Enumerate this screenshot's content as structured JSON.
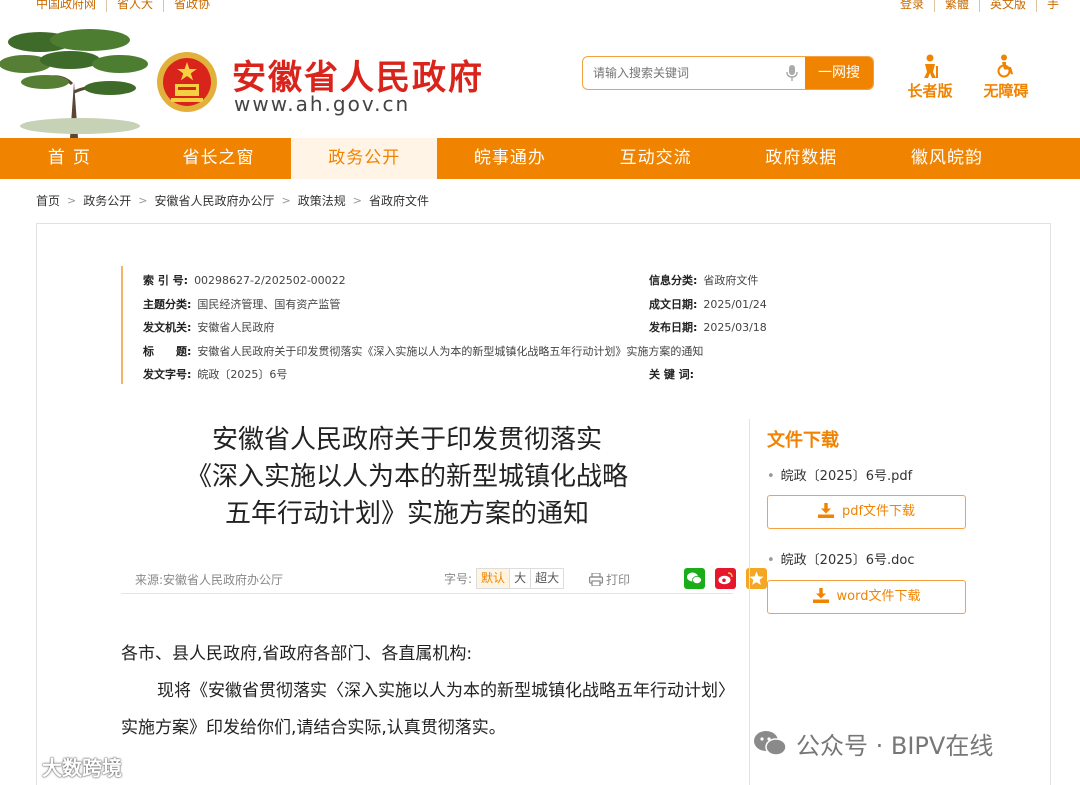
{
  "top_links": {
    "left": [
      "中国政府网",
      "省人大",
      "省政协"
    ],
    "right": [
      "登录",
      "繁體",
      "英文版",
      "手"
    ]
  },
  "header": {
    "site_title": "安徽省人民政府",
    "site_url": "www.ah.gov.cn",
    "search_placeholder": "请输入搜索关键词",
    "search_button": "一网搜",
    "elder_label": "长者版",
    "accessible_label": "无障碍"
  },
  "nav": {
    "items": [
      "首页",
      "省长之窗",
      "政务公开",
      "皖事通办",
      "互动交流",
      "政府数据",
      "徽风皖韵"
    ],
    "active_index": 2
  },
  "breadcrumb": [
    "首页",
    "政务公开",
    "安徽省人民政府办公厅",
    "政策法规",
    "省政府文件"
  ],
  "meta": {
    "index_no_label": "索 引 号:",
    "index_no": "00298627-2/202502-00022",
    "info_cat_label": "信息分类:",
    "info_cat": "省政府文件",
    "topic_label": "主题分类:",
    "topic": "国民经济管理、国有资产监管",
    "made_date_label": "成文日期:",
    "made_date": "2025/01/24",
    "issuer_label": "发文机关:",
    "issuer": "安徽省人民政府",
    "pub_date_label": "发布日期:",
    "pub_date": "2025/03/18",
    "title_label": "标　　题:",
    "title": "安徽省人民政府关于印发贯彻落实《深入实施以人为本的新型城镇化战略五年行动计划》实施方案的通知",
    "doc_no_label": "发文字号:",
    "doc_no": "皖政〔2025〕6号",
    "keywords_label": "关 键 词:",
    "keywords": ""
  },
  "doc": {
    "title_line1": "安徽省人民政府关于印发贯彻落实",
    "title_line2": "《深入实施以人为本的新型城镇化战略",
    "title_line3": "五年行动计划》实施方案的通知",
    "source": "来源:安徽省人民政府办公厅",
    "font_size_label": "字号:",
    "font_sizes": [
      "默认",
      "大",
      "超大"
    ],
    "print_label": "打印",
    "salutation": "各市、县人民政府,省政府各部门、各直属机构:",
    "body": "现将《安徽省贯彻落实〈深入实施以人为本的新型城镇化战略五年行动计划〉实施方案》印发给你们,请结合实际,认真贯彻落实。"
  },
  "downloads": {
    "heading": "文件下载",
    "files": [
      {
        "name": "皖政〔2025〕6号.pdf",
        "button": "pdf文件下载"
      },
      {
        "name": "皖政〔2025〕6号.doc",
        "button": "word文件下载"
      }
    ]
  },
  "watermarks": {
    "left": "大数跨境",
    "right": "公众号 · BIPV在线"
  },
  "colors": {
    "brand_orange": "#f08300",
    "title_red": "#d9241b",
    "wechat_green": "#1aad19",
    "weibo_red": "#e6162d",
    "fav_orange": "#f5a623"
  }
}
